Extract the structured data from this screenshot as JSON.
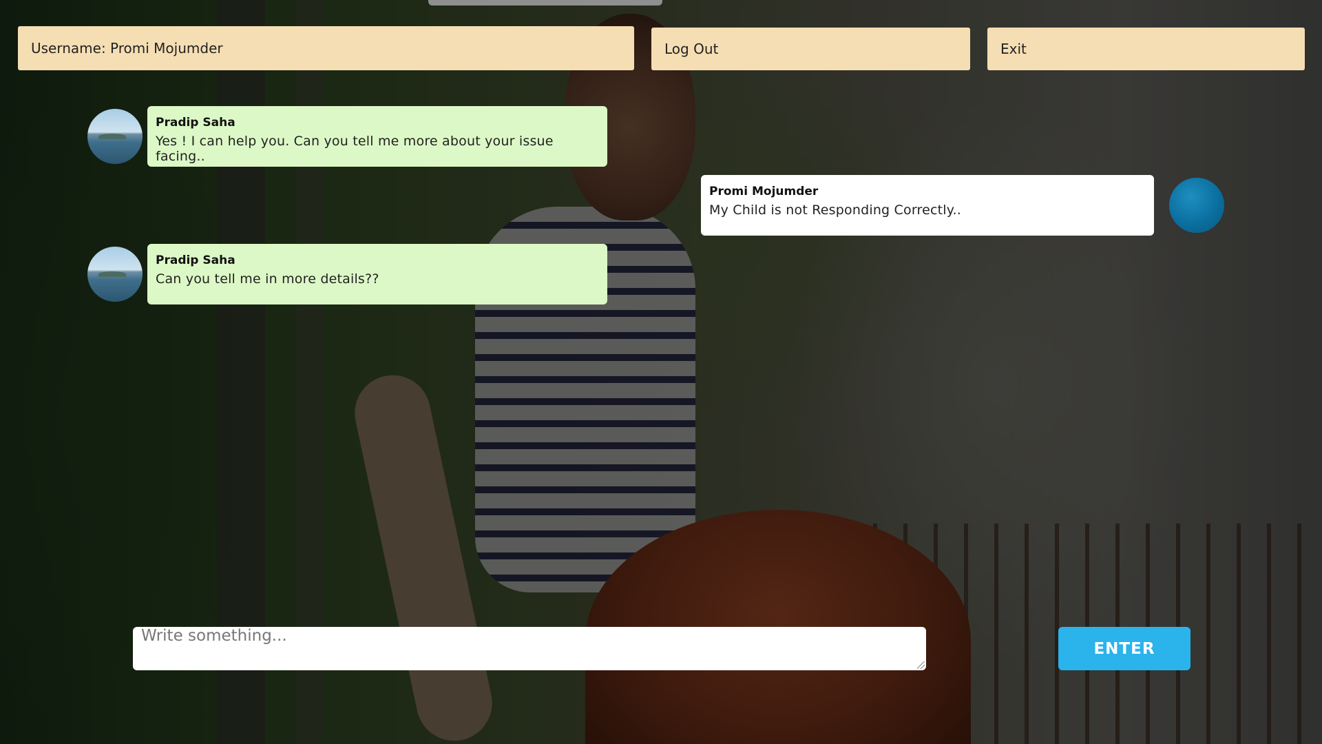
{
  "header": {
    "username": "Username: Promi Mojumder",
    "logout_label": "Log Out",
    "exit_label": "Exit"
  },
  "messages": [
    {
      "sender": "Pradip Saha",
      "text": "Yes ! I can help you. Can you tell me more about your issue facing..",
      "side": "left",
      "bubble_color": "#dcf8c6"
    },
    {
      "sender": "Promi Mojumder",
      "text": "My Child is not Responding Correctly..",
      "side": "right",
      "bubble_color": "#ffffff"
    },
    {
      "sender": "Pradip Saha",
      "text": "Can you tell me in more details??",
      "side": "left",
      "bubble_color": "#dcf8c6"
    }
  ],
  "composer": {
    "value": "",
    "placeholder": "Write something..."
  },
  "enter_label": "ENTER",
  "colors": {
    "header_bar": "#f5deb3",
    "incoming_bubble": "#dcf8c6",
    "outgoing_bubble": "#ffffff",
    "accent": "#2bb3ec"
  }
}
